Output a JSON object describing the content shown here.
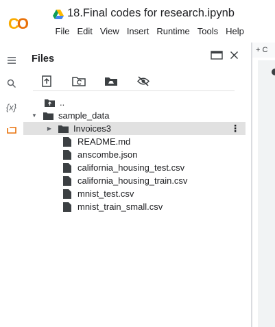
{
  "header": {
    "logo": "CO",
    "title": "18.Final codes for research.ipynb",
    "menu": [
      "File",
      "Edit",
      "View",
      "Insert",
      "Runtime",
      "Tools",
      "Help"
    ]
  },
  "rail": {
    "icons": [
      "menu-icon",
      "search-icon",
      "variables-icon",
      "files-icon"
    ],
    "variables_glyph": "{x}"
  },
  "files_panel": {
    "title": "Files",
    "toolbar": [
      "upload-icon",
      "refresh-icon",
      "mount-drive-icon",
      "hide-files-icon"
    ],
    "tree": [
      {
        "label": "..",
        "type": "parent-folder",
        "depth": 0
      },
      {
        "label": "sample_data",
        "type": "folder",
        "depth": 0,
        "expanded": true
      },
      {
        "label": "Invoices3",
        "type": "folder",
        "depth": 1,
        "expanded": false,
        "selected": true
      },
      {
        "label": "README.md",
        "type": "file",
        "depth": 1
      },
      {
        "label": "anscombe.json",
        "type": "file",
        "depth": 1
      },
      {
        "label": "california_housing_test.csv",
        "type": "file",
        "depth": 1
      },
      {
        "label": "california_housing_train.csv",
        "type": "file",
        "depth": 1
      },
      {
        "label": "mnist_test.csv",
        "type": "file",
        "depth": 1
      },
      {
        "label": "mnist_train_small.csv",
        "type": "file",
        "depth": 1
      }
    ]
  },
  "notebook": {
    "add_code_label": "+ C"
  },
  "colors": {
    "accent": "#e8710a",
    "logo_yellow": "#f9ab00",
    "selected_row": "#e1e1e1"
  }
}
